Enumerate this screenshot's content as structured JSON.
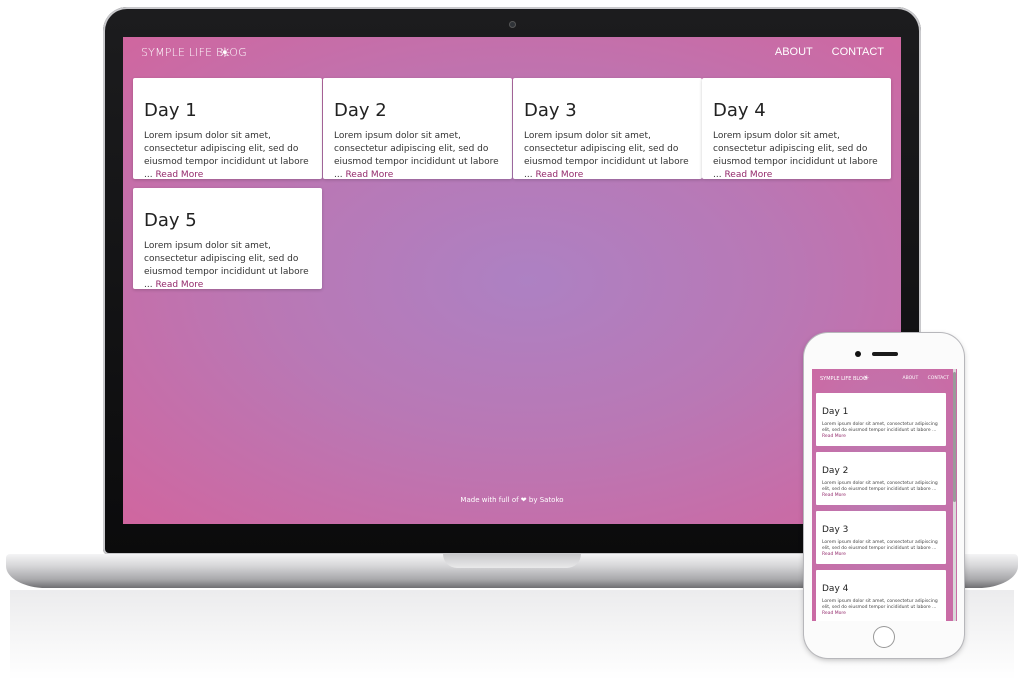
{
  "desktop": {
    "brand": "Symple Life Blog",
    "brand_icon": "sun-heart-icon",
    "nav": {
      "about": "About",
      "contact": "Contact"
    },
    "posts": [
      {
        "title": "Day 1",
        "excerpt": "Lorem ipsum dolor sit amet, consectetur adipiscing elit, sed do eiusmod tempor incididunt ut labore ... ",
        "read_more": "Read More"
      },
      {
        "title": "Day 2",
        "excerpt": "Lorem ipsum dolor sit amet, consectetur adipiscing elit, sed do eiusmod tempor incididunt ut labore ... ",
        "read_more": "Read More"
      },
      {
        "title": "Day 3",
        "excerpt": "Lorem ipsum dolor sit amet, consectetur adipiscing elit, sed do eiusmod tempor incididunt ut labore ... ",
        "read_more": "Read More"
      },
      {
        "title": "Day 4",
        "excerpt": "Lorem ipsum dolor sit amet, consectetur adipiscing elit, sed do eiusmod tempor incididunt ut labore ... ",
        "read_more": "Read More"
      },
      {
        "title": "Day 5",
        "excerpt": "Lorem ipsum dolor sit amet, consectetur adipiscing elit, sed do eiusmod tempor incididunt ut labore ... ",
        "read_more": "Read More"
      }
    ],
    "footer": {
      "prefix": "Made with full of ",
      "suffix": " by Satoko"
    }
  },
  "mobile": {
    "brand": "Symple Life Blog",
    "nav": {
      "about": "About",
      "contact": "Contact"
    },
    "posts": [
      {
        "title": "Day 1",
        "excerpt": "Lorem ipsum dolor sit amet, consectetur adipiscing elit, sed do eiusmod tempor incididunt ut labore ...",
        "read_more": "Read More"
      },
      {
        "title": "Day 2",
        "excerpt": "Lorem ipsum dolor sit amet, consectetur adipiscing elit, sed do eiusmod tempor incididunt ut labore ...",
        "read_more": "Read More"
      },
      {
        "title": "Day 3",
        "excerpt": "Lorem ipsum dolor sit amet, consectetur adipiscing elit, sed do eiusmod tempor incididunt ut labore ...",
        "read_more": "Read More"
      },
      {
        "title": "Day 4",
        "excerpt": "Lorem ipsum dolor sit amet, consectetur adipiscing elit, sed do eiusmod tempor incididunt ut labore ...",
        "read_more": "Read More"
      }
    ]
  },
  "colors": {
    "accent": "#93296b",
    "gradient_center": "#ad81c3",
    "gradient_edge": "#d0669f"
  }
}
